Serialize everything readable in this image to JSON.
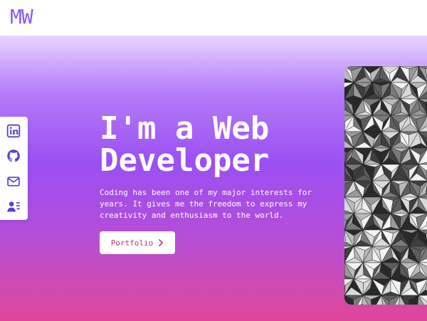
{
  "navbar": {
    "logo": "MW"
  },
  "socials": [
    {
      "name": "LinkedIn",
      "icon": "linkedin-icon"
    },
    {
      "name": "GitHub",
      "icon": "github-icon"
    },
    {
      "name": "Email",
      "icon": "mail-icon"
    },
    {
      "name": "Resume",
      "icon": "resume-icon"
    }
  ],
  "hero": {
    "headline_line1": "I'm a Web",
    "headline_line2": "Developer",
    "tagline": "Coding has been one of my major interests for years. It gives me the freedom to express my creativity and enthusiasm to the world.",
    "cta_label": "Portfolio",
    "cta_icon": "chevron-right-icon"
  },
  "colors": {
    "accent": "#8b5cf6",
    "icon": "#5b3fd1",
    "cta_text": "#b83c8a",
    "gradient_top": "#e9d5ff",
    "gradient_mid": "#9b4ff3",
    "gradient_bottom": "#e0459c"
  },
  "images": {
    "hero_art": "geometric-triangles-image"
  }
}
